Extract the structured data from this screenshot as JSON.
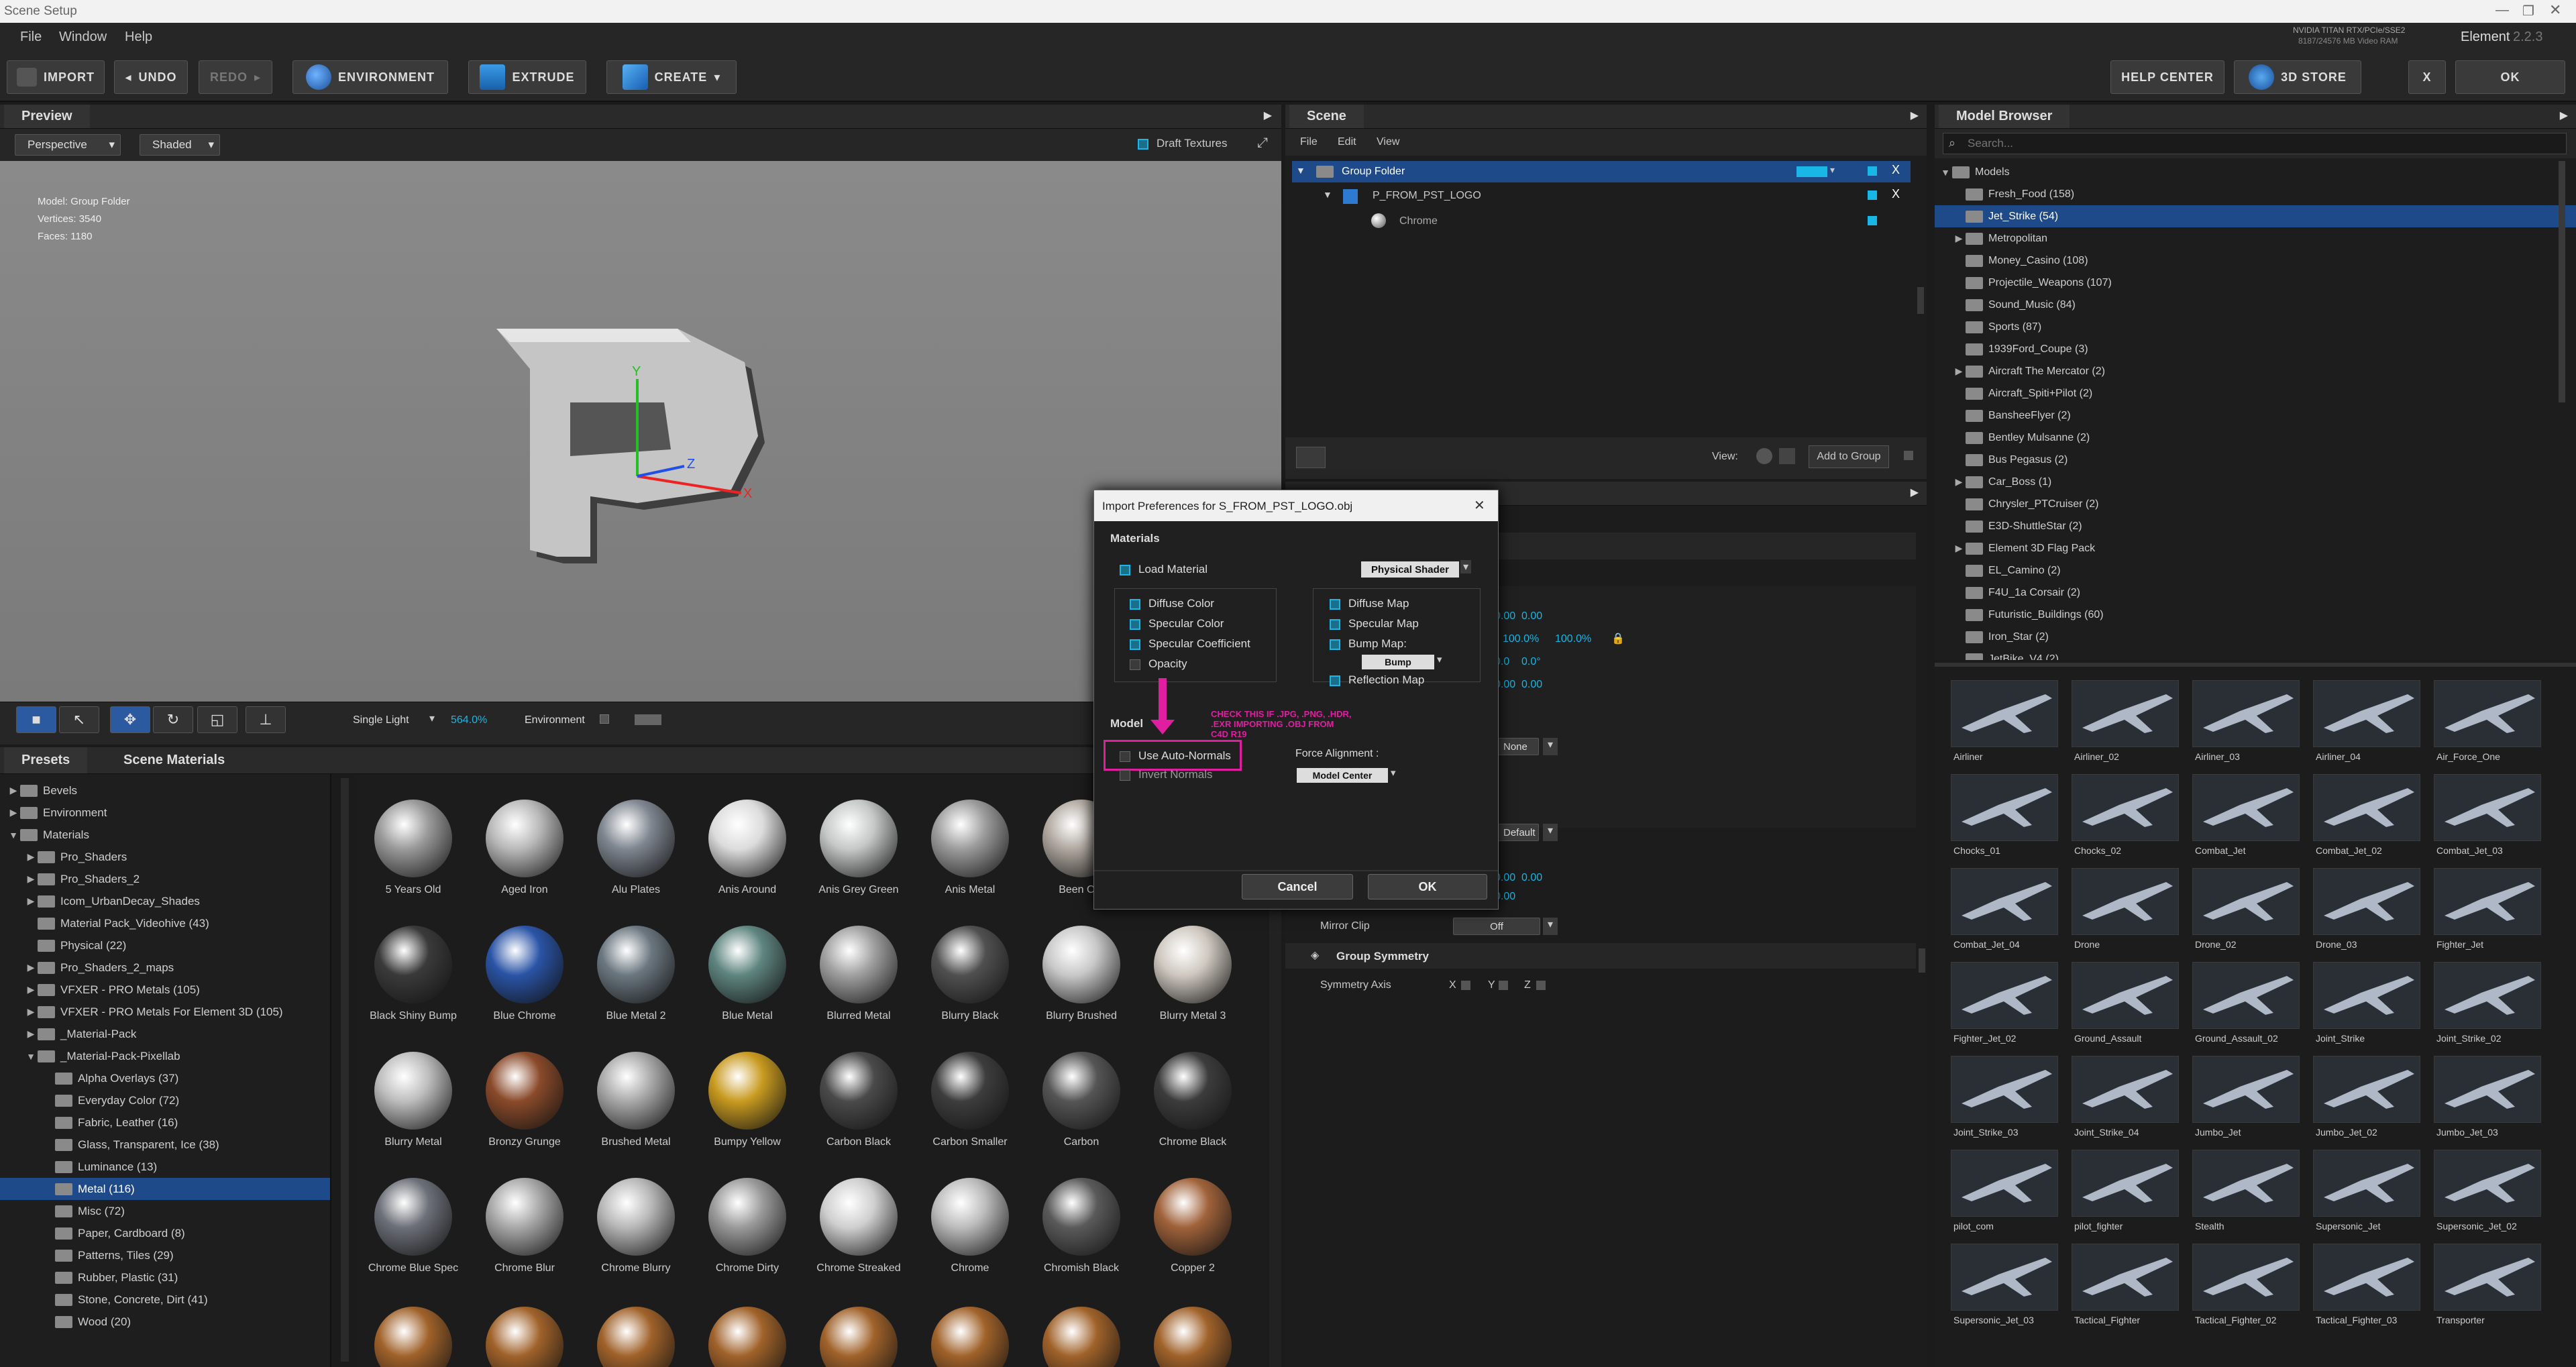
{
  "app": {
    "title": "Scene Setup",
    "gpu": "NVIDIA TITAN RTX/PCIe/SSE2",
    "vram": "8187/24576 MB Video RAM",
    "product": "Element",
    "version": "2.2.3"
  },
  "menu": [
    "File",
    "Window",
    "Help"
  ],
  "toolbar": {
    "import": "IMPORT",
    "undo": "UNDO",
    "redo": "REDO",
    "environment": "ENVIRONMENT",
    "extrude": "EXTRUDE",
    "create": "CREATE",
    "help_center": "HELP CENTER",
    "store": "3D STORE",
    "close": "X",
    "ok": "OK"
  },
  "preview": {
    "title": "Preview",
    "view_mode": "Perspective",
    "shading": "Shaded",
    "draft_textures": "Draft Textures",
    "model_info": [
      "Model: Group Folder",
      "Vertices: 3540",
      "Faces: 1180"
    ],
    "light": "Single Light",
    "zoom": "564.0%",
    "environment": "Environment"
  },
  "scene": {
    "title": "Scene",
    "menu": [
      "File",
      "Edit",
      "View"
    ],
    "items": [
      {
        "label": "Group Folder"
      },
      {
        "label": "P_FROM_PST_LOGO"
      },
      {
        "label": "Chrome"
      }
    ],
    "view_label": "View:",
    "add_to_group": "Add to Group",
    "x_label": "X"
  },
  "properties": {
    "values": [
      "0.00",
      "0.00",
      "100.0%",
      "100.0%",
      "0.0",
      "0.0°",
      "0.00",
      "0.00",
      "0.00",
      "0.00",
      "0.00",
      "0.00"
    ],
    "none_dd": "None",
    "default_dd": "Default",
    "mirror_clip_label": "Mirror Clip",
    "mirror_clip_value": "Off",
    "group_symmetry": "Group Symmetry",
    "symmetry_axis": "Symmetry Axis",
    "axes": [
      "X",
      "Y",
      "Z"
    ]
  },
  "presets": {
    "tabs": [
      "Presets",
      "Scene Materials"
    ],
    "tree": [
      {
        "label": "Bevels",
        "indent": 0,
        "arrow": "▶"
      },
      {
        "label": "Environment",
        "indent": 0,
        "arrow": "▶"
      },
      {
        "label": "Materials",
        "indent": 0,
        "arrow": "▼"
      },
      {
        "label": "Pro_Shaders",
        "indent": 1,
        "arrow": "▶"
      },
      {
        "label": "Pro_Shaders_2",
        "indent": 1,
        "arrow": "▶"
      },
      {
        "label": "Icom_UrbanDecay_Shades",
        "indent": 1,
        "arrow": "▶"
      },
      {
        "label": "Material Pack_Videohive (43)",
        "indent": 1,
        "arrow": ""
      },
      {
        "label": "Physical (22)",
        "indent": 1,
        "arrow": ""
      },
      {
        "label": "Pro_Shaders_2_maps",
        "indent": 1,
        "arrow": "▶"
      },
      {
        "label": "VFXER - PRO Metals (105)",
        "indent": 1,
        "arrow": "▶"
      },
      {
        "label": "VFXER - PRO Metals For Element 3D (105)",
        "indent": 1,
        "arrow": "▶"
      },
      {
        "label": "_Material-Pack",
        "indent": 1,
        "arrow": "▶"
      },
      {
        "label": "_Material-Pack-Pixellab",
        "indent": 1,
        "arrow": "▼"
      },
      {
        "label": "Alpha Overlays (37)",
        "indent": 2,
        "arrow": ""
      },
      {
        "label": "Everyday Color (72)",
        "indent": 2,
        "arrow": ""
      },
      {
        "label": "Fabric, Leather (16)",
        "indent": 2,
        "arrow": ""
      },
      {
        "label": "Glass, Transparent, Ice (38)",
        "indent": 2,
        "arrow": ""
      },
      {
        "label": "Luminance (13)",
        "indent": 2,
        "arrow": ""
      },
      {
        "label": "Metal (116)",
        "indent": 2,
        "arrow": "",
        "selected": true
      },
      {
        "label": "Misc (72)",
        "indent": 2,
        "arrow": ""
      },
      {
        "label": "Paper, Cardboard (8)",
        "indent": 2,
        "arrow": ""
      },
      {
        "label": "Patterns, Tiles (29)",
        "indent": 2,
        "arrow": ""
      },
      {
        "label": "Rubber, Plastic (31)",
        "indent": 2,
        "arrow": ""
      },
      {
        "label": "Stone, Concrete, Dirt (41)",
        "indent": 2,
        "arrow": ""
      },
      {
        "label": "Wood (20)",
        "indent": 2,
        "arrow": ""
      }
    ]
  },
  "materials": [
    {
      "label": "5 Years Old",
      "color": "#9a9a9a"
    },
    {
      "label": "Aged Iron",
      "color": "#b9b9b9"
    },
    {
      "label": "Alu Plates",
      "color": "#7f8690"
    },
    {
      "label": "Anis Around",
      "color": "#dcdcdc"
    },
    {
      "label": "Anis Grey Green",
      "color": "#c4c8c6"
    },
    {
      "label": "Anis Metal",
      "color": "#9c9c9c"
    },
    {
      "label": "Been Out",
      "color": "#b0a8a0"
    },
    {
      "label": "",
      "color": "#000"
    },
    {
      "label": "Black Shiny Bump",
      "color": "#3a3a3a"
    },
    {
      "label": "Blue Chrome",
      "color": "#2a54a6"
    },
    {
      "label": "Blue Metal 2",
      "color": "#6b7780"
    },
    {
      "label": "Blue Metal",
      "color": "#5f8580"
    },
    {
      "label": "Blurred Metal",
      "color": "#a0a0a0"
    },
    {
      "label": "Blurry Black",
      "color": "#505050"
    },
    {
      "label": "Blurry Brushed",
      "color": "#c8c8c8"
    },
    {
      "label": "Blurry Metal 3",
      "color": "#cfc8c0"
    },
    {
      "label": "Blurry Metal",
      "color": "#bdbdbd"
    },
    {
      "label": "Bronzy Grunge",
      "color": "#8a4a2a"
    },
    {
      "label": "Brushed Metal",
      "color": "#a9a9a9"
    },
    {
      "label": "Bumpy Yellow",
      "color": "#c89a20"
    },
    {
      "label": "Carbon Black",
      "color": "#4a4a4a"
    },
    {
      "label": "Carbon Smaller",
      "color": "#3d3d3d"
    },
    {
      "label": "Carbon",
      "color": "#555555"
    },
    {
      "label": "Chrome Black",
      "color": "#3c3c3c"
    },
    {
      "label": "Chrome Blue Spec",
      "color": "#6c7078"
    },
    {
      "label": "Chrome Blur",
      "color": "#a8a8a8"
    },
    {
      "label": "Chrome Blurry",
      "color": "#b8b8b8"
    },
    {
      "label": "Chrome Dirty",
      "color": "#9a9a9a"
    },
    {
      "label": "Chrome Streaked",
      "color": "#cfcfcf"
    },
    {
      "label": "Chrome",
      "color": "#bcbcbc"
    },
    {
      "label": "Chromish Black",
      "color": "#5a5a5a"
    },
    {
      "label": "Copper 2",
      "color": "#a0623a"
    }
  ],
  "model_browser": {
    "title": "Model Browser",
    "search_placeholder": "Search...",
    "tree": [
      {
        "label": "Models",
        "arrow": "▼",
        "indent": 0
      },
      {
        "label": "Fresh_Food (158)",
        "indent": 1
      },
      {
        "label": "Jet_Strike (54)",
        "indent": 1,
        "selected": true
      },
      {
        "label": "Metropolitan",
        "indent": 1,
        "arrow": "▶"
      },
      {
        "label": "Money_Casino (108)",
        "indent": 1
      },
      {
        "label": "Projectile_Weapons (107)",
        "indent": 1
      },
      {
        "label": "Sound_Music (84)",
        "indent": 1
      },
      {
        "label": "Sports (87)",
        "indent": 1
      },
      {
        "label": "1939Ford_Coupe (3)",
        "indent": 1
      },
      {
        "label": "Aircraft The Mercator (2)",
        "indent": 1,
        "arrow": "▶"
      },
      {
        "label": "Aircraft_Spiti+Pilot (2)",
        "indent": 1
      },
      {
        "label": "BansheeFlyer (2)",
        "indent": 1
      },
      {
        "label": "Bentley Mulsanne (2)",
        "indent": 1
      },
      {
        "label": "Bus Pegasus (2)",
        "indent": 1
      },
      {
        "label": "Car_Boss (1)",
        "indent": 1,
        "arrow": "▶"
      },
      {
        "label": "Chrysler_PTCruiser (2)",
        "indent": 1
      },
      {
        "label": "E3D-ShuttleStar (2)",
        "indent": 1
      },
      {
        "label": "Element 3D Flag Pack",
        "indent": 1,
        "arrow": "▶"
      },
      {
        "label": "EL_Camino (2)",
        "indent": 1
      },
      {
        "label": "F4U_1a Corsair (2)",
        "indent": 1
      },
      {
        "label": "Futuristic_Buildings (60)",
        "indent": 1
      },
      {
        "label": "Iron_Star (2)",
        "indent": 1
      },
      {
        "label": "JetBike_V4 (2)",
        "indent": 1
      }
    ],
    "thumbs": [
      "Airliner",
      "Airliner_02",
      "Airliner_03",
      "Airliner_04",
      "Air_Force_One",
      "Chocks_01",
      "Chocks_02",
      "Combat_Jet",
      "Combat_Jet_02",
      "Combat_Jet_03",
      "Combat_Jet_04",
      "Drone",
      "Drone_02",
      "Drone_03",
      "Fighter_Jet",
      "Fighter_Jet_02",
      "Ground_Assault",
      "Ground_Assault_02",
      "Joint_Strike",
      "Joint_Strike_02",
      "Joint_Strike_03",
      "Joint_Strike_04",
      "Jumbo_Jet",
      "Jumbo_Jet_02",
      "Jumbo_Jet_03",
      "pilot_com",
      "pilot_fighter",
      "Stealth",
      "Supersonic_Jet",
      "Supersonic_Jet_02",
      "Supersonic_Jet_03",
      "Tactical_Fighter",
      "Tactical_Fighter_02",
      "Tactical_Fighter_03",
      "Transporter"
    ]
  },
  "dialog": {
    "title": "Import Preferences for S_FROM_PST_LOGO.obj",
    "materials_header": "Materials",
    "load_material": "Load Material",
    "shader": "Physical Shader",
    "left_opts": [
      "Diffuse Color",
      "Specular Color",
      "Specular Coefficient",
      "Opacity"
    ],
    "right_opts": [
      "Diffuse Map",
      "Specular Map",
      "Bump Map:",
      "Reflection Map"
    ],
    "bump_value": "Bump",
    "model_header": "Model",
    "auto_normals": "Use Auto-Normals",
    "invert_normals": "Invert Normals",
    "force_alignment": "Force Alignment :",
    "alignment_value": "Model Center",
    "annotation": "CHECK THIS IF .JPG, .PNG, .HDR, .EXR IMPORTING .OBJ FROM C4D R19",
    "cancel": "Cancel",
    "ok": "OK",
    "close": "✕"
  },
  "colors": {
    "accent": "#19b7e6",
    "selection": "#1f4a8a",
    "annotation": "#e01ea0"
  }
}
